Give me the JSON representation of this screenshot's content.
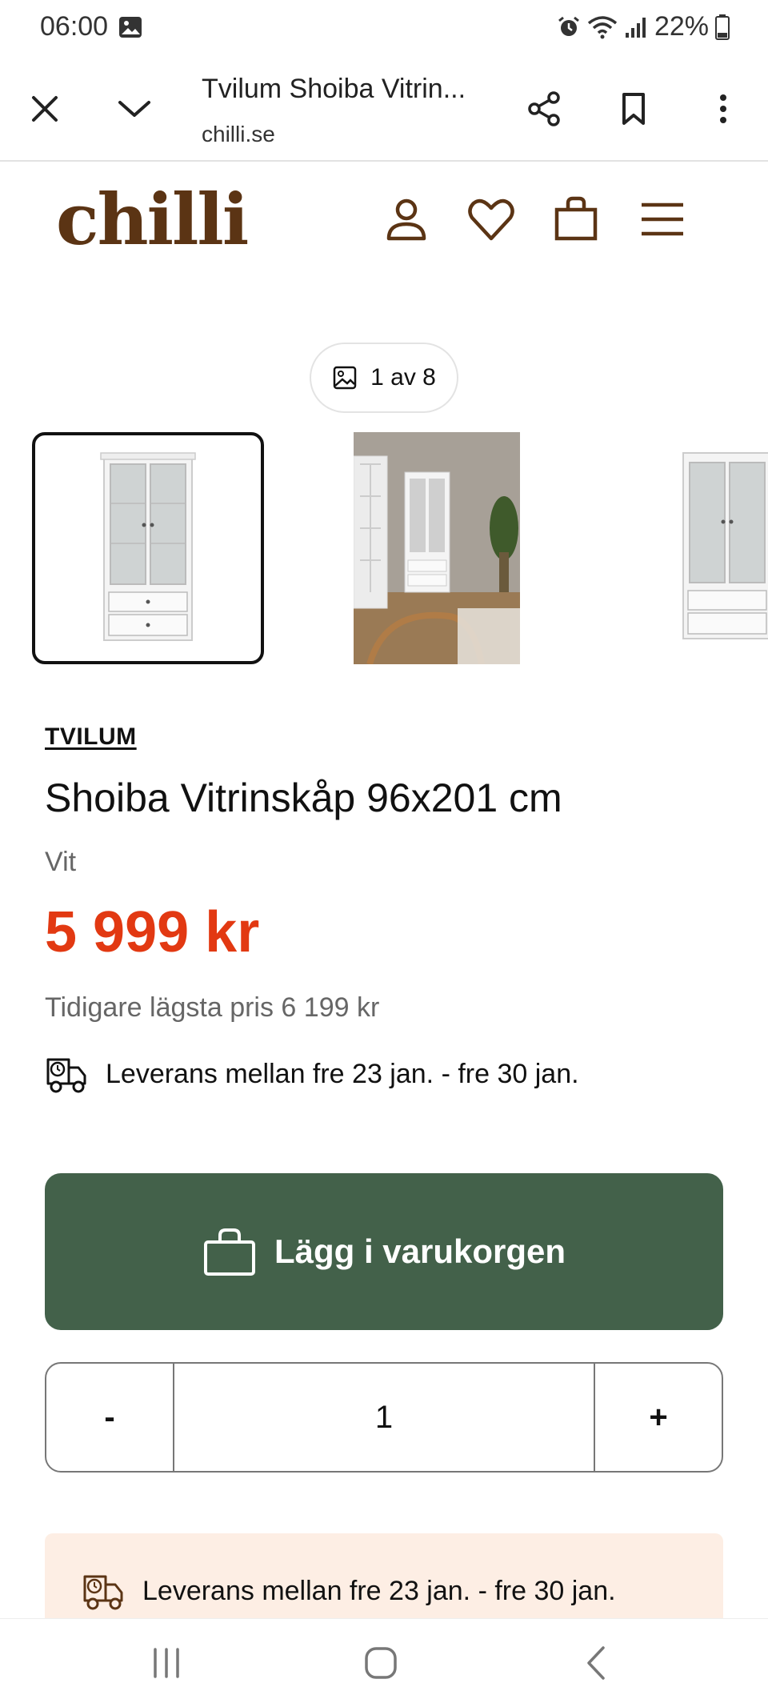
{
  "status_bar": {
    "time": "06:00",
    "battery": "22%"
  },
  "browser": {
    "title": "Tvilum Shoiba Vitrin...",
    "domain": "chilli.se"
  },
  "site": {
    "logo": "chilli"
  },
  "gallery": {
    "counter": "1 av 8"
  },
  "product": {
    "brand": "TVILUM",
    "title": "Shoiba Vitrinskåp 96x201 cm",
    "variant": "Vit",
    "price": "5 999 kr",
    "previous_lowest_price": "Tidigare lägsta pris 6 199 kr",
    "delivery": "Leverans mellan fre 23 jan. - fre 30 jan."
  },
  "cart": {
    "button_label": "Lägg i varukorgen"
  },
  "quantity": {
    "minus": "-",
    "value": "1",
    "plus": "+"
  },
  "banner": {
    "delivery": "Leverans mellan fre 23 jan. - fre 30 jan."
  },
  "colors": {
    "brand": "#5b3414",
    "price": "#e23912",
    "cart_button": "#43614a",
    "banner_bg": "#fdeee4"
  },
  "icons": {
    "status": [
      "image-icon",
      "alarm-icon",
      "wifi-icon",
      "signal-icon",
      "battery-icon"
    ],
    "browser": [
      "close-icon",
      "chevron-down-icon",
      "share-icon",
      "bookmark-icon",
      "more-vertical-icon"
    ],
    "header": [
      "user-icon",
      "heart-icon",
      "shopping-bag-icon",
      "menu-icon"
    ],
    "nav": [
      "recent-apps-icon",
      "home-icon",
      "back-icon"
    ]
  }
}
